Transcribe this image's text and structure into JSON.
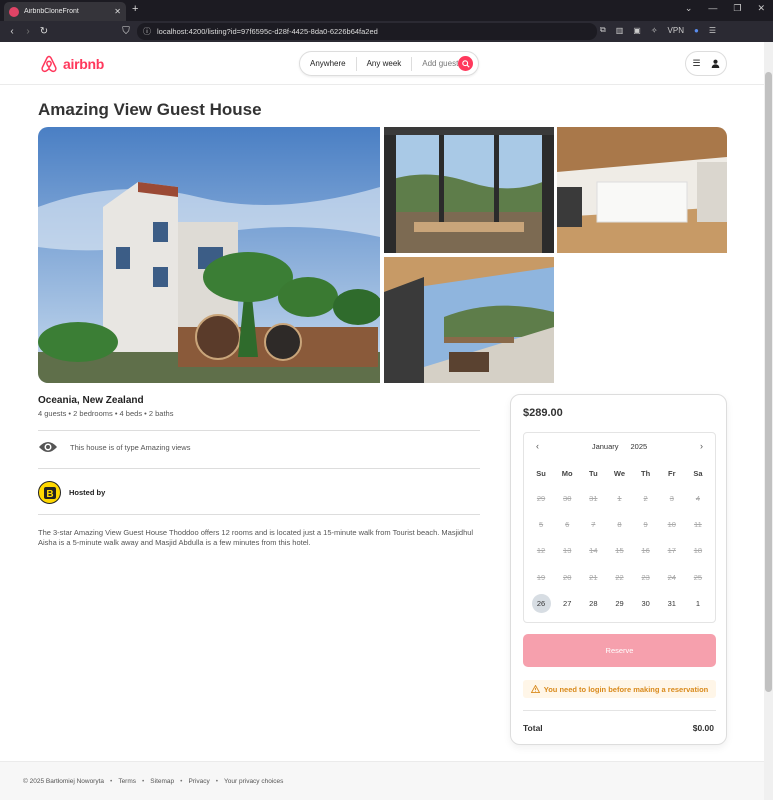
{
  "browser": {
    "tab_title": "AirbnbCloneFront",
    "new_tab": "+",
    "url": "localhost:4200/listing?id=97f6595c-d28f-4425-8da0-6226b64fa2ed",
    "vpn_label": "VPN"
  },
  "header": {
    "logo_text": "airbnb",
    "search": {
      "where": "Anywhere",
      "when": "Any week",
      "guests": "Add guests"
    }
  },
  "listing": {
    "title": "Amazing View Guest House",
    "location": "Oceania, New Zealand",
    "details": "4 guests • 2 bedrooms • 4 beds • 2 baths",
    "category_text": "This house is of type Amazing views",
    "hosted_by": "Hosted by",
    "description": "The 3-star Amazing View Guest House Thoddoo offers 12 rooms and is located just a 15-minute walk from Tourist beach. Masjidhul Aisha is a 5-minute walk away and Masjid Abdulla is a few minutes from this hotel."
  },
  "reservation": {
    "price": "$289.00",
    "calendar": {
      "month": "January",
      "year": "2025",
      "weekdays": [
        "Su",
        "Mo",
        "Tu",
        "We",
        "Th",
        "Fr",
        "Sa"
      ],
      "days": [
        {
          "d": "29",
          "past": true
        },
        {
          "d": "30",
          "past": true
        },
        {
          "d": "31",
          "past": true
        },
        {
          "d": "1",
          "past": true
        },
        {
          "d": "2",
          "past": true
        },
        {
          "d": "3",
          "past": true
        },
        {
          "d": "4",
          "past": true
        },
        {
          "d": "5",
          "past": true
        },
        {
          "d": "6",
          "past": true
        },
        {
          "d": "7",
          "past": true
        },
        {
          "d": "8",
          "past": true
        },
        {
          "d": "9",
          "past": true
        },
        {
          "d": "10",
          "past": true
        },
        {
          "d": "11",
          "past": true
        },
        {
          "d": "12",
          "past": true
        },
        {
          "d": "13",
          "past": true
        },
        {
          "d": "14",
          "past": true
        },
        {
          "d": "15",
          "past": true
        },
        {
          "d": "16",
          "past": true
        },
        {
          "d": "17",
          "past": true
        },
        {
          "d": "18",
          "past": true
        },
        {
          "d": "19",
          "past": true
        },
        {
          "d": "20",
          "past": true
        },
        {
          "d": "21",
          "past": true
        },
        {
          "d": "22",
          "past": true
        },
        {
          "d": "23",
          "past": true
        },
        {
          "d": "24",
          "past": true
        },
        {
          "d": "25",
          "past": true
        },
        {
          "d": "26",
          "today": true
        },
        {
          "d": "27"
        },
        {
          "d": "28"
        },
        {
          "d": "29"
        },
        {
          "d": "30"
        },
        {
          "d": "31"
        },
        {
          "d": "1"
        }
      ]
    },
    "reserve_label": "Reserve",
    "login_warning": "You need to login before making a reservation",
    "total_label": "Total",
    "total_value": "$0.00"
  },
  "footer": {
    "copyright": "© 2025 Bartłomiej Noworyta",
    "links": [
      "Terms",
      "Sitemap",
      "Privacy",
      "Your privacy choices"
    ]
  },
  "colors": {
    "brand": "#ff385c",
    "reserve_disabled": "#f6a0ad",
    "warning": "#d98a1c"
  }
}
